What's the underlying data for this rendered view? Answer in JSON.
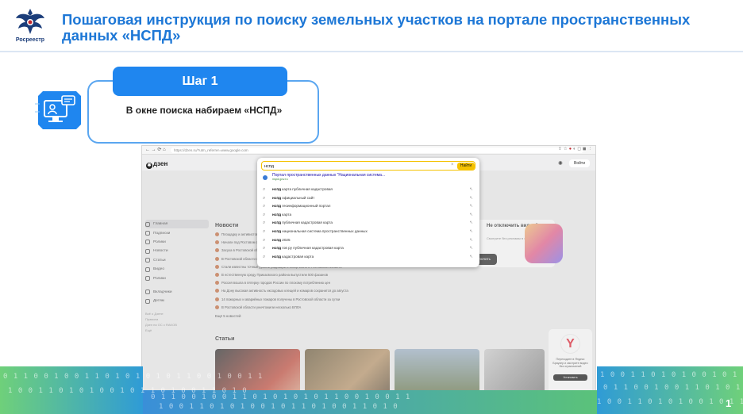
{
  "header": {
    "logo_text": "Росреестр",
    "title": "Пошаговая инструкция по поиску земельных участков на портале пространственных данных «НСПД»"
  },
  "step": {
    "label": "Шаг 1",
    "text": "В окне поиска набираем «НСПД»"
  },
  "browser": {
    "url": "https://dzen.ru/?utm_referrer=www.google.com",
    "nav": "← → ⟳ ⌂"
  },
  "dzen": {
    "logo": "дзен",
    "login": "Войти",
    "sidebar": [
      {
        "label": "Главная",
        "active": true
      },
      {
        "label": "Подписки"
      },
      {
        "label": "Ролики"
      },
      {
        "label": "Новости"
      },
      {
        "label": "Статьи"
      },
      {
        "label": "Видео"
      },
      {
        "label": "Ролики"
      },
      {
        "label": "Вкладчики"
      },
      {
        "label": "Детям"
      }
    ],
    "sidebar_small": [
      "Всё о Дзене",
      "Правила",
      "Дзен на ОС с RAKOB",
      "Ещё"
    ],
    "news_title": "Новости",
    "news": [
      "Площадку и активистов поддержали в Ростове и области",
      "Начали под Ростовом строительство нового объекта",
      "Засуха в Ростовской области продолжается",
      "В Ростовской области объявлено штормовое предупреждение",
      "Стали известны точные уровни радиации в конце июля в Ростовской области",
      "В естественную среду Приазовского района выпустили 500 фазанов",
      "Россия вошла в пятерку городов России по плохому потреблению цен",
      "На Дону высокая активность иксодовых клещей и комаров сохранится до августа",
      "14 пожарных и аварийных пожаров получены в Ростовской области за сутки",
      "В Ростовской области уничтожили несколько БПЛА"
    ],
    "news_more": "Ещё 5 новостей",
    "articles_title": "Статьи",
    "promo_title": "Не отключить видео?",
    "promo_sub": "Смотрите без рекламы в хорошем качестве",
    "promo_btn": "Отключить",
    "ya_text": "Переходите в Яндекс Браузер и смотрите видео без ограничений",
    "ya_btn": "Установить"
  },
  "search": {
    "value": "нспд",
    "button": "Найти",
    "top_suggestion": {
      "title": "Портал пространственных данных \"Национальная система...",
      "url": "nspd.gov.ru"
    },
    "suggestions": [
      {
        "bold": "нспд",
        "rest": " карта публичная кадастровая"
      },
      {
        "bold": "нспд",
        "rest": " официальный сайт"
      },
      {
        "bold": "нспд",
        "rest": " геоинформационный портал"
      },
      {
        "bold": "нспд",
        "rest": " карта"
      },
      {
        "bold": "нспд",
        "rest": " публичная кадастровая карта"
      },
      {
        "bold": "нспд",
        "rest": " национальная система пространственных данных"
      },
      {
        "bold": "нспд",
        "rest": " 2025"
      },
      {
        "bold": "нспд",
        "rest": " гов ру публичная кадастровая карта"
      },
      {
        "bold": "нспд",
        "rest": " кадастровая карта"
      }
    ]
  },
  "footer": {
    "page_number": "1",
    "binary_1": "0 1 1 0 0 1 0 0 1 1 0 1 0 1 0 1 0 1 1 0 0 1 0 0 1 1",
    "binary_2": "1 0 0 1 1 0 1 0 1 0 0 1 0 1 1 0 1 0 0 1 1 0 1 0"
  },
  "colors": {
    "title": "#1d77d6",
    "step_pill": "#1f86ef",
    "step_border": "#5aa6f0",
    "search_accent": "#f5c200"
  }
}
